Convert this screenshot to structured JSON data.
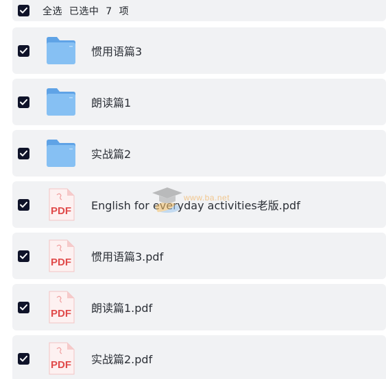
{
  "header": {
    "select_all_text": "全选  已选中  7  项"
  },
  "files": [
    {
      "name": "惯用语篇3",
      "type": "folder",
      "checked": true
    },
    {
      "name": "朗读篇1",
      "type": "folder",
      "checked": true
    },
    {
      "name": "实战篇2",
      "type": "folder",
      "checked": true
    },
    {
      "name": "English for everyday activities老版.pdf",
      "type": "pdf",
      "checked": true
    },
    {
      "name": "惯用语篇3.pdf",
      "type": "pdf",
      "checked": true
    },
    {
      "name": "朗读篇1.pdf",
      "type": "pdf",
      "checked": true
    },
    {
      "name": "实战篇2.pdf",
      "type": "pdf",
      "checked": true
    }
  ],
  "pdf_badge": "PDF",
  "watermark": {
    "text": "www.ba.net"
  },
  "colors": {
    "checkbox": "#0f1329",
    "row_bg": "#f1f2f4",
    "folder": "#7cb8f0",
    "pdf_red": "#e04a4a"
  }
}
